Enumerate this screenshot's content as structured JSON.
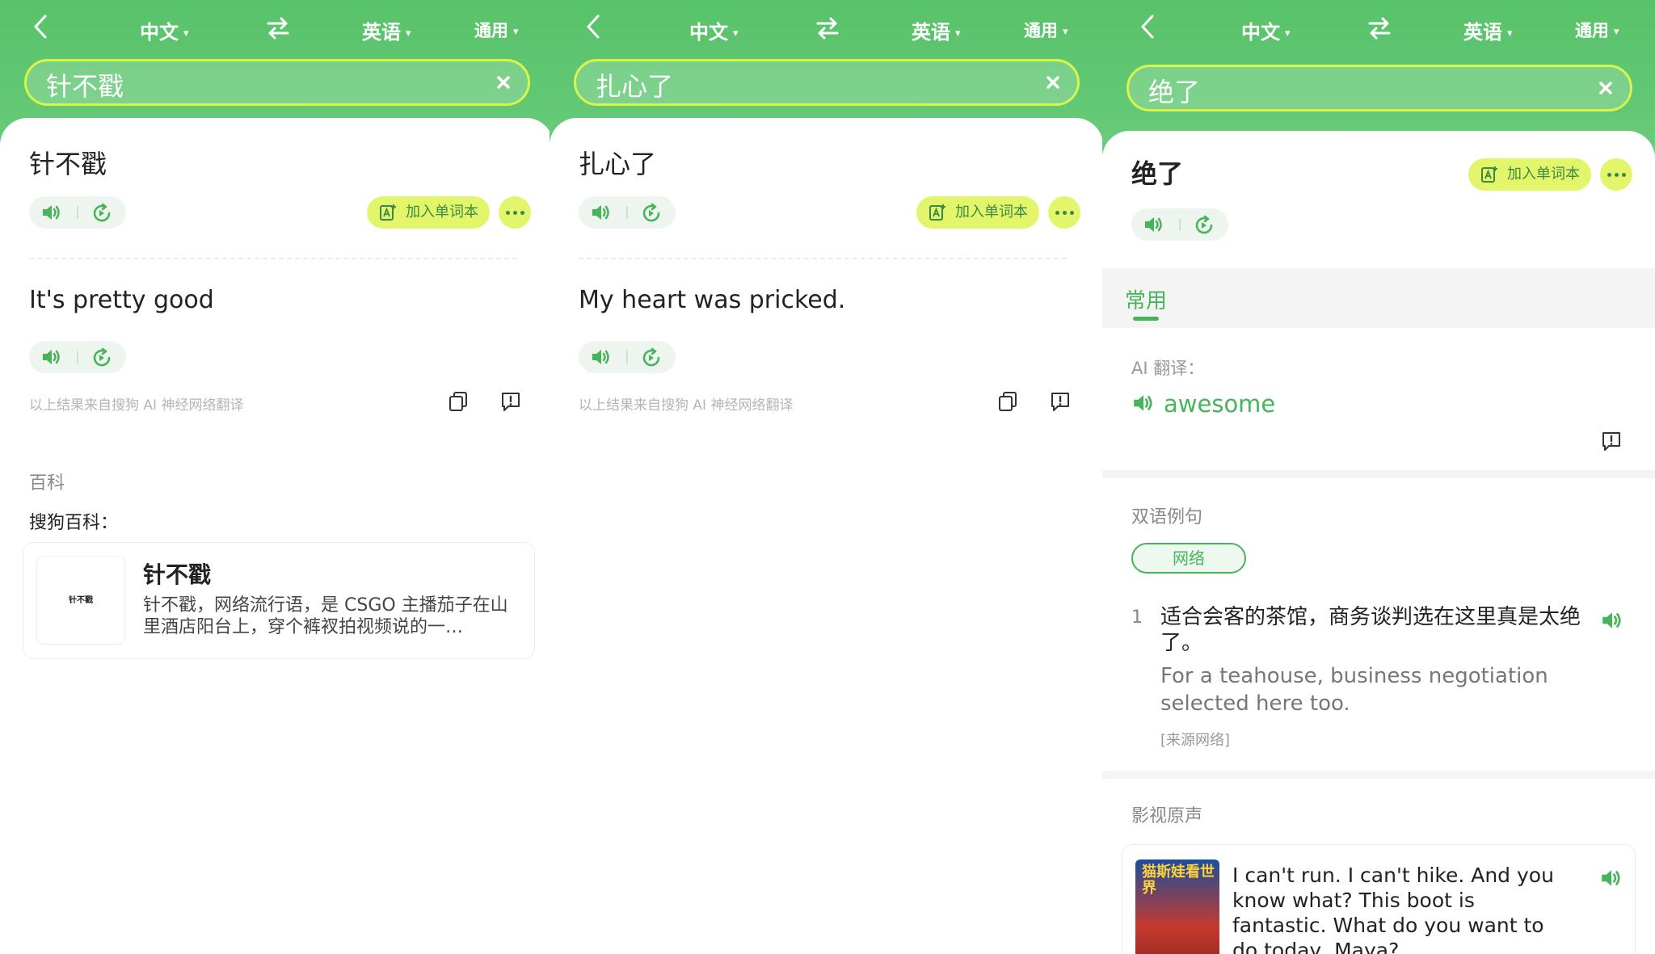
{
  "colors": {
    "brand_green": "#58c26a",
    "accent_lime": "#e3f56a",
    "text_green": "#47b45c"
  },
  "panels": [
    {
      "header": {
        "source_lang": "中文",
        "target_lang": "英语",
        "mode": "通用"
      },
      "query": "针不戳",
      "source_text": "针不戳",
      "add_button": "加入单词本",
      "translation": "It's pretty good",
      "attribution": "以上结果来自搜狗 AI 神经网络翻译",
      "encyclopedia": {
        "section": "百科",
        "provider": "搜狗百科：",
        "card_title": "针不戳",
        "thumb_text": "针不戳",
        "card_desc": "针不戳，网络流行语，是 CSGO 主播茄子在山里酒店阳台上，穿个裤衩拍视频说的一…"
      }
    },
    {
      "header": {
        "source_lang": "中文",
        "target_lang": "英语",
        "mode": "通用"
      },
      "query": "扎心了",
      "source_text": "扎心了",
      "add_button": "加入单词本",
      "translation": "My heart was pricked.",
      "attribution": "以上结果来自搜狗 AI 神经网络翻译"
    },
    {
      "header": {
        "source_lang": "中文",
        "target_lang": "英语",
        "mode": "通用"
      },
      "query": "绝了",
      "source_text": "绝了",
      "add_button": "加入单词本",
      "tab": "常用",
      "ai_label": "AI 翻译：",
      "ai_word": "awesome",
      "examples_section": "双语例句",
      "examples_chip": "网络",
      "example": {
        "num": "1",
        "cn": "适合会客的茶馆，商务谈判选在这里真是太绝了。",
        "en": "For a teahouse, business negotiation selected here too.",
        "source": "[来源网络]"
      },
      "film_section": "影视原声",
      "film": {
        "poster_text": "猫斯娃看世界",
        "quote": "I can't run. I can't hike. And you know what? This boot is fantastic. What do you want to do today, Maya?"
      }
    }
  ]
}
